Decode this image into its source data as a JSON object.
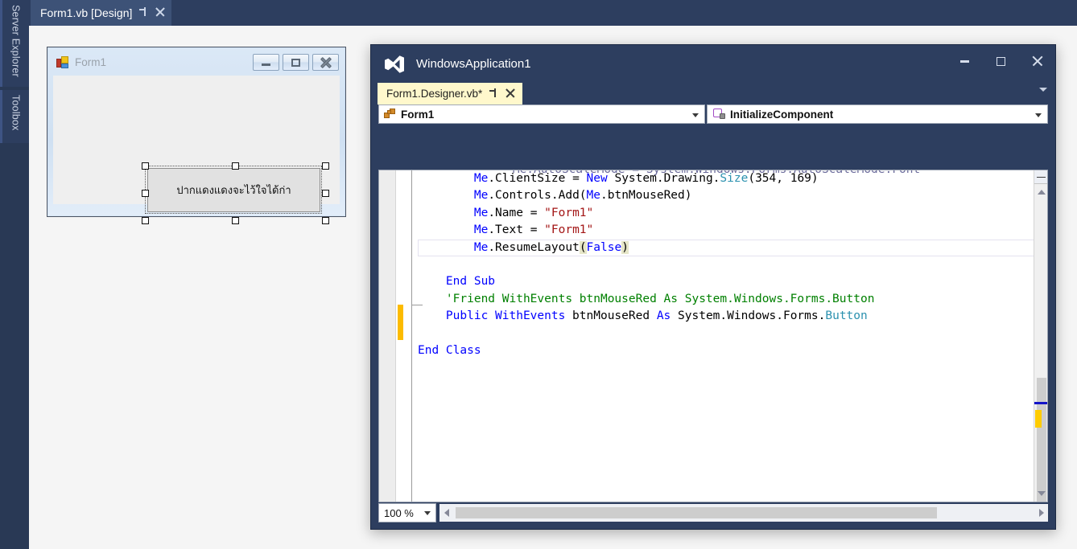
{
  "dock": {
    "tabs": [
      {
        "label": "Server Explorer",
        "name": "server-explorer"
      },
      {
        "label": "Toolbox",
        "name": "toolbox"
      }
    ]
  },
  "designer": {
    "tab": {
      "label": "Form1.vb [Design]",
      "pin_icon": "pin-icon",
      "close_icon": "close-icon"
    },
    "form": {
      "title": "Form1",
      "icon": "vb-form-icon",
      "minimize_label": "—",
      "maximize_label": "□",
      "close_label": "✕",
      "button": {
        "text": "ปากแดงแดงจะไว้ใจได้ก่า",
        "selected": true,
        "handles": 8
      }
    }
  },
  "code_window": {
    "app_title": "WindowsApplication1",
    "logo_icon": "visual-studio-logo-icon",
    "window_buttons": {
      "minimize": "minimize-icon",
      "maximize": "maximize-icon",
      "close": "close-icon"
    },
    "document_tab": {
      "label": "Form1.Designer.vb*",
      "pin_icon": "pin-icon",
      "close_icon": "close-icon"
    },
    "navigation": {
      "type_label": "Form1",
      "type_icon": "class-icon",
      "member_label": "InitializeComponent",
      "member_icon": "method-private-icon",
      "chevron_icon": "chevron-down-icon"
    },
    "editor": {
      "cut_top_line": "        Me.AutoScaleMode = System.Windows.Forms.AutoScaleMode.Font",
      "lines": [
        {
          "indent": "        ",
          "tokens": [
            {
              "t": "Me",
              "c": "kw"
            },
            {
              "t": ".ClientSize = ",
              "c": "plain"
            },
            {
              "t": "New",
              "c": "kw"
            },
            {
              "t": " System.Drawing.",
              "c": "plain"
            },
            {
              "t": "Size",
              "c": "typ"
            },
            {
              "t": "(354, 169)",
              "c": "plain"
            }
          ]
        },
        {
          "indent": "        ",
          "tokens": [
            {
              "t": "Me",
              "c": "kw"
            },
            {
              "t": ".Controls.Add(",
              "c": "plain"
            },
            {
              "t": "Me",
              "c": "kw"
            },
            {
              "t": ".btnMouseRed)",
              "c": "plain"
            }
          ]
        },
        {
          "indent": "        ",
          "tokens": [
            {
              "t": "Me",
              "c": "kw"
            },
            {
              "t": ".Name = ",
              "c": "plain"
            },
            {
              "t": "\"Form1\"",
              "c": "str"
            }
          ]
        },
        {
          "indent": "        ",
          "tokens": [
            {
              "t": "Me",
              "c": "kw"
            },
            {
              "t": ".Text = ",
              "c": "plain"
            },
            {
              "t": "\"Form1\"",
              "c": "str"
            }
          ]
        },
        {
          "indent": "        ",
          "highlight": true,
          "tokens": [
            {
              "t": "Me",
              "c": "kw"
            },
            {
              "t": ".ResumeLayout",
              "c": "plain"
            },
            {
              "t": "(",
              "c": "brace"
            },
            {
              "t": "False",
              "c": "kw"
            },
            {
              "t": ")",
              "c": "brace"
            }
          ]
        },
        {
          "indent": "",
          "tokens": []
        },
        {
          "indent": "    ",
          "tokens": [
            {
              "t": "End Sub",
              "c": "kw"
            }
          ]
        },
        {
          "indent": "    ",
          "tokens": [
            {
              "t": "'Friend WithEvents btnMouseRed As System.Windows.Forms.Button",
              "c": "cmt"
            }
          ]
        },
        {
          "indent": "    ",
          "tokens": [
            {
              "t": "Public WithEvents",
              "c": "kw"
            },
            {
              "t": " btnMouseRed ",
              "c": "plain"
            },
            {
              "t": "As",
              "c": "kw"
            },
            {
              "t": " System.Windows.Forms.",
              "c": "plain"
            },
            {
              "t": "Button",
              "c": "typ"
            }
          ]
        },
        {
          "indent": "",
          "tokens": []
        },
        {
          "indent": "",
          "tokens": [
            {
              "t": "End Class",
              "c": "kw"
            }
          ]
        }
      ]
    },
    "status": {
      "zoom_value": "100 %",
      "zoom_chevron": "chevron-down-icon",
      "hscroll_left_icon": "arrow-left-icon",
      "hscroll_right_icon": "arrow-right-icon"
    },
    "scrollbar": {
      "up_icon": "arrow-up-icon",
      "down_icon": "arrow-down-icon",
      "splitter_icon": "split-view-icon",
      "marker_caret": "caret-position-marker",
      "marker_change": "unsaved-change-marker"
    }
  },
  "colors": {
    "vs_chrome": "#2d3e5f",
    "dock_strip": "#293955",
    "active_doc_tab": "#fff8cc",
    "designer_tab": "#3d5277",
    "keyword": "#0000ff",
    "type": "#2b91af",
    "string": "#a31515",
    "comment": "#008000",
    "change_bar": "#fcbb00",
    "caret_marker": "#1414c8"
  }
}
